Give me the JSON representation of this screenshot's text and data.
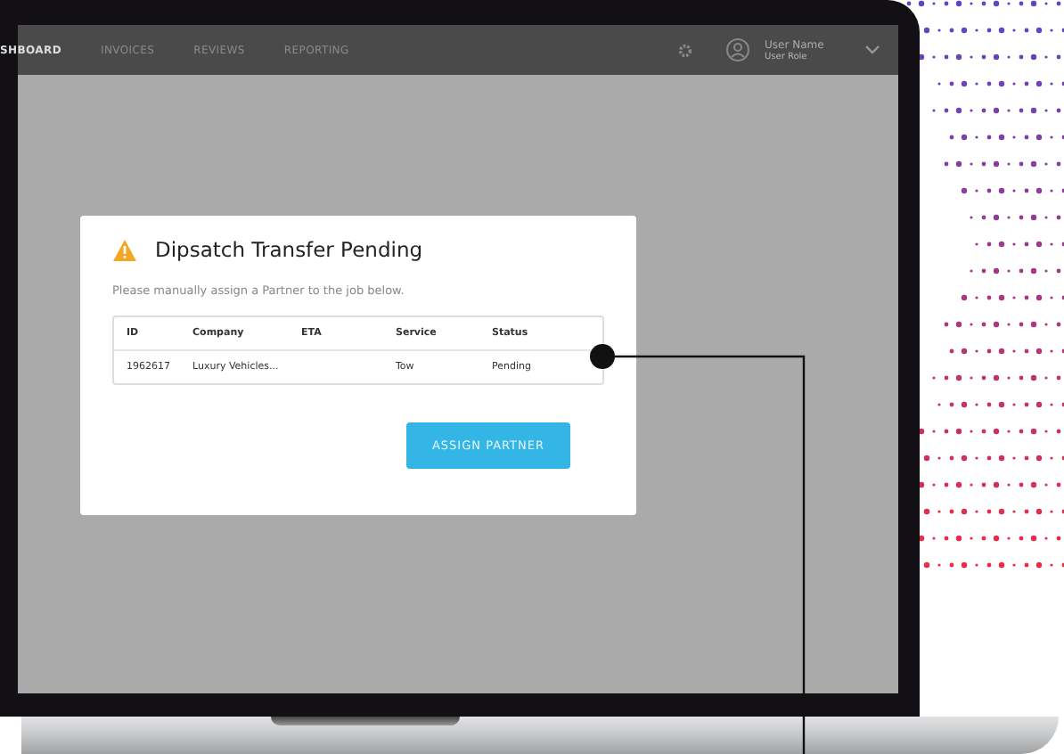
{
  "nav": {
    "items": [
      {
        "label": "SHBOARD",
        "selected": true
      },
      {
        "label": "INVOICES",
        "selected": false
      },
      {
        "label": "REVIEWS",
        "selected": false
      },
      {
        "label": "REPORTING",
        "selected": false
      }
    ],
    "user": {
      "name": "User Name",
      "role": "User Role"
    }
  },
  "dialog": {
    "title": "Dipsatch Transfer Pending",
    "message": "Please manually assign a Partner to the job below.",
    "table": {
      "columns": [
        "ID",
        "Company",
        "ETA",
        "Service",
        "Status"
      ],
      "rows": [
        [
          "1962617",
          "Luxury Vehicles...",
          null,
          "Tow",
          "Pending"
        ]
      ]
    },
    "button": "ASSIGN PARTNER"
  }
}
